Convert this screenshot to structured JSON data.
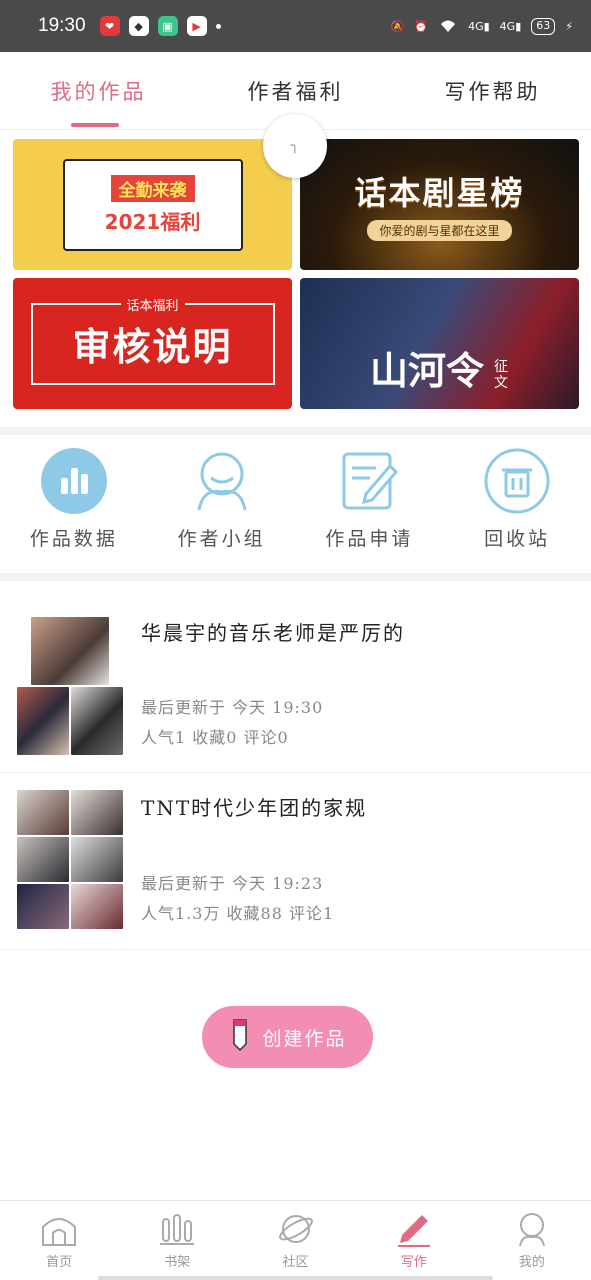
{
  "status": {
    "time": "19:30",
    "signal1": "4G",
    "signal2": "4G",
    "battery": "63"
  },
  "tabs": [
    {
      "label": "我的作品",
      "active": true
    },
    {
      "label": "作者福利",
      "active": false
    },
    {
      "label": "写作帮助",
      "active": false
    }
  ],
  "banners": {
    "b1": {
      "line1": "全勤来袭",
      "line2": "2021福利"
    },
    "b2": {
      "title": "话本剧星榜",
      "subtitle": "你爱的剧与星都在这里"
    },
    "b3": {
      "tag": "话本福利",
      "title": "审核说明"
    },
    "b4": {
      "title": "山河令",
      "subtitle": "征文"
    }
  },
  "quick": [
    {
      "label": "作品数据",
      "icon": "bar-chart-icon"
    },
    {
      "label": "作者小组",
      "icon": "group-icon"
    },
    {
      "label": "作品申请",
      "icon": "edit-document-icon"
    },
    {
      "label": "回收站",
      "icon": "trash-icon"
    }
  ],
  "works": [
    {
      "title": "华晨宇的音乐老师是严厉的",
      "updated": "最后更新于 今天 19:30",
      "stats": "人气1 收藏0 评论0"
    },
    {
      "title": "TNT时代少年团的家规",
      "updated": "最后更新于 今天 19:23",
      "stats": "人气1.3万 收藏88 评论1"
    }
  ],
  "create_label": "创建作品",
  "nav": [
    {
      "label": "首页",
      "icon": "home-icon",
      "active": false
    },
    {
      "label": "书架",
      "icon": "bookshelf-icon",
      "active": false
    },
    {
      "label": "社区",
      "icon": "planet-icon",
      "active": false
    },
    {
      "label": "写作",
      "icon": "pen-icon",
      "active": true
    },
    {
      "label": "我的",
      "icon": "profile-icon",
      "active": false
    }
  ],
  "colors": {
    "accent": "#e06b84",
    "icon_blue": "#8ecae8",
    "create_bg": "#f38db4"
  }
}
